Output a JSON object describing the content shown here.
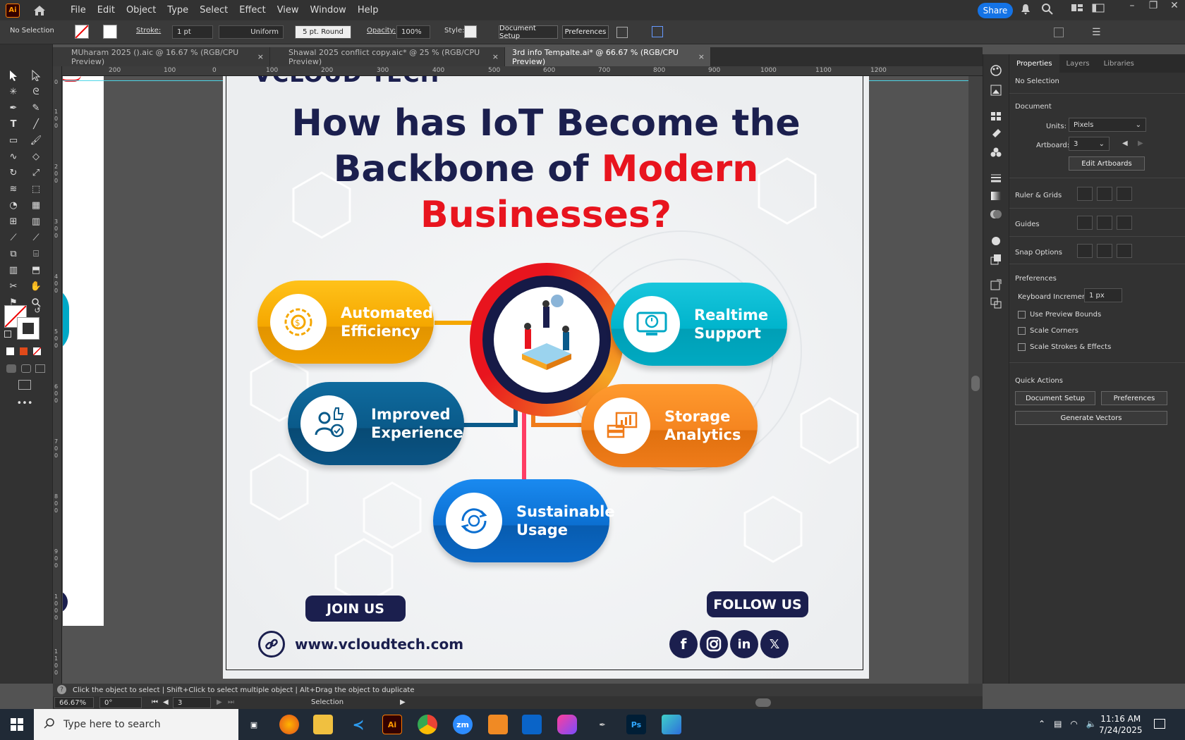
{
  "app": {
    "logo": "Ai",
    "menu": [
      "File",
      "Edit",
      "Object",
      "Type",
      "Select",
      "Effect",
      "View",
      "Window",
      "Help"
    ],
    "share_label": "Share"
  },
  "control_bar": {
    "selection": "No Selection",
    "stroke_label": "Stroke:",
    "stroke_value": "1 pt",
    "profile": "Uniform",
    "brush": "5 pt. Round",
    "opacity_label": "Opacity:",
    "opacity_value": "100%",
    "style_label": "Style:",
    "doc_setup": "Document Setup",
    "preferences": "Preferences"
  },
  "tabs": [
    {
      "label": "MUharam 2025 ().aic @ 16.67 % (RGB/CPU Preview)",
      "active": false
    },
    {
      "label": "Shawal 2025 conflict copy.aic* @ 25 % (RGB/CPU Preview)",
      "active": false
    },
    {
      "label": "3rd info Tempalte.ai* @ 66.67 % (RGB/CPU Preview)",
      "active": true
    }
  ],
  "tab_close": "×",
  "ruler_h": [
    "200",
    "100",
    "0",
    "100",
    "200",
    "300",
    "400",
    "500",
    "600",
    "700",
    "800",
    "900",
    "1000",
    "1100",
    "1200"
  ],
  "ruler_v": [
    "0",
    "1 0 0",
    "2 0 0",
    "3 0 0",
    "4 0 0",
    "5 0 0",
    "6 0 0",
    "7 0 0",
    "8 0 0",
    "9 0 0",
    "1 0 0 0",
    "1 1 0 0"
  ],
  "artboard": {
    "brand_partial": "VCLOUD TECH",
    "headline_line1": "How has IoT Become the",
    "headline_line2_a": "Backbone of ",
    "headline_line2_b": "Modern",
    "headline_line3": "Businesses?",
    "items": {
      "automated": {
        "line1": "Automated",
        "line2": "Efficiency"
      },
      "realtime": {
        "line1": "Realtime",
        "line2": "Support"
      },
      "improved": {
        "line1": "Improved",
        "line2": "Experience"
      },
      "storage": {
        "line1": "Storage",
        "line2": "Analytics"
      },
      "sustainable": {
        "line1": "Sustainable",
        "line2": "Usage"
      }
    },
    "join_us": "JOIN US",
    "follow_us": "FOLLOW US",
    "website": "www.vcloudtech.com",
    "social": {
      "facebook": "f",
      "linkedin": "in",
      "x": "𝕏"
    },
    "colors": {
      "navy": "#1b1f4e",
      "red": "#e8141e",
      "yellow": "#f5a700",
      "cyan": "#00a8c6",
      "blue": "#0a5a8a",
      "orange": "#f07c1a",
      "royal": "#0b6fd1"
    }
  },
  "panel": {
    "tabs": [
      "Properties",
      "Layers",
      "Libraries"
    ],
    "no_selection": "No Selection",
    "document": "Document",
    "units_label": "Units:",
    "units_value": "Pixels",
    "artboard_label": "Artboard:",
    "artboard_value": "3",
    "edit_artboards": "Edit Artboards",
    "ruler_grids": "Ruler & Grids",
    "guides": "Guides",
    "snap_options": "Snap Options",
    "preferences": "Preferences",
    "keyboard_increment_label": "Keyboard Increment:",
    "keyboard_increment_value": "1 px",
    "checks": [
      "Use Preview Bounds",
      "Scale Corners",
      "Scale Strokes & Effects"
    ],
    "quick_actions": "Quick Actions",
    "document_setup": "Document Setup",
    "preferences_btn": "Preferences",
    "generate_vectors": "Generate Vectors"
  },
  "status": {
    "hint": "Click the object to select  |  Shift+Click to select multiple object  |  Alt+Drag the object to duplicate",
    "zoom": "66.67%",
    "rotation": "0°",
    "artboard_nav": "3",
    "mode": "Selection"
  },
  "taskbar": {
    "search_placeholder": "Type here to search",
    "time": "11:16 AM",
    "date": "7/24/2025",
    "zm": "zm",
    "ps": "Ps"
  }
}
